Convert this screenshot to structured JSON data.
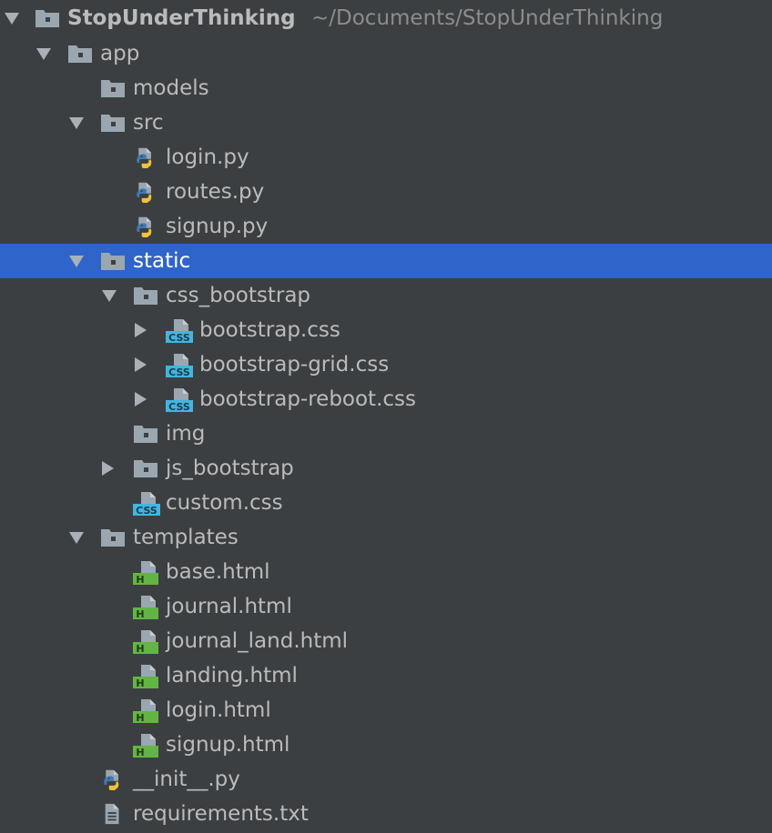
{
  "tree": {
    "root": {
      "name": "StopUnderThinking",
      "path": "~/Documents/StopUnderThinking"
    },
    "app": "app",
    "models": "models",
    "src": "src",
    "login_py": "login.py",
    "routes_py": "routes.py",
    "signup_py": "signup.py",
    "static": "static",
    "css_bootstrap": "css_bootstrap",
    "bootstrap_css": "bootstrap.css",
    "bootstrap_grid_css": "bootstrap-grid.css",
    "bootstrap_reboot_css": "bootstrap-reboot.css",
    "img": "img",
    "js_bootstrap": "js_bootstrap",
    "custom_css": "custom.css",
    "templates": "templates",
    "base_html": "base.html",
    "journal_html": "journal.html",
    "journal_land_html": "journal_land.html",
    "landing_html": "landing.html",
    "login_html": "login.html",
    "signup_html": "signup.html",
    "init_py": "__init__.py",
    "requirements_txt": "requirements.txt"
  },
  "icons": {
    "folder": "folder-icon",
    "python": "python-file-icon",
    "css": "css-file-icon",
    "html": "html-file-icon",
    "text": "text-file-icon"
  },
  "css_icon_text": "CSS",
  "html_icon_text": "H",
  "colors": {
    "background": "#3c3f41",
    "selection": "#2f65ca",
    "text": "#bbbbbb",
    "path_text": "#8c8c8c",
    "folder": "#9aa7b0",
    "css_badge": "#40b6e0",
    "html_badge": "#62b543"
  }
}
